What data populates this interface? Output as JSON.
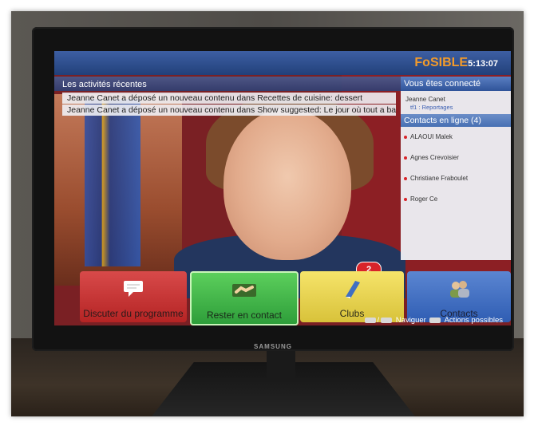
{
  "tv": {
    "brand": "SAMSUNG"
  },
  "header": {
    "logo": "FoSIBLE",
    "time": "5:13:07"
  },
  "recent_activities": {
    "title": "Les activités récentes",
    "items": [
      "Jeanne Canet a déposé un nouveau contenu dans Recettes de cuisine: dessert",
      "Jeanne Canet a déposé un nouveau contenu dans Show suggested: Le jour où tout a bas..."
    ]
  },
  "connected": {
    "title": "Vous êtes connecté",
    "user": "Jeanne Canet",
    "channel": "tf1 : Reportages",
    "online_title": "Contacts en ligne (4)",
    "contacts": [
      "ALAOUI Malek",
      "Agnes Crevoisier",
      "Christiane Fraboulet",
      "Roger Ce"
    ]
  },
  "tiles": [
    {
      "label": "Discuter du programme",
      "icon": "speech-bubble-icon"
    },
    {
      "label": "Rester en contact",
      "icon": "handshake-icon",
      "badge": "2"
    },
    {
      "label": "Clubs",
      "icon": "book-icon"
    },
    {
      "label": "Contacts",
      "icon": "people-icon"
    }
  ],
  "footer": {
    "nav_sep": "/",
    "nav_label": "Naviguer",
    "actions_label": "Actions possibles"
  }
}
